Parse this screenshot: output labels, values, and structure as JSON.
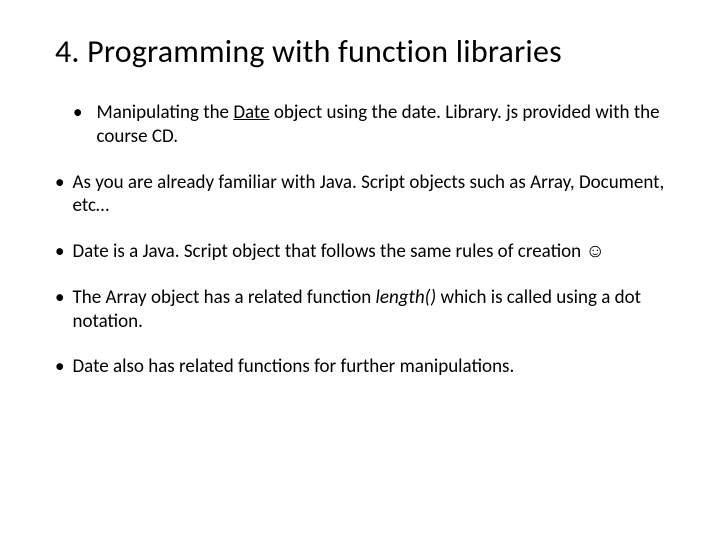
{
  "title": "4. Programming with function libraries",
  "bullets": [
    {
      "pre": "Manipulating the ",
      "u": "Date",
      "post": " object using the date. Library. js provided with the course CD."
    },
    {
      "text": "As you are already familiar with Java. Script objects such as Array, Document, etc…"
    },
    {
      "text": "Date is a Java. Script object that follows the same rules of creation ☺"
    },
    {
      "pre": "The Array object has a related function ",
      "i": "length()",
      "post": " which is called using a dot notation."
    },
    {
      "text": "Date also has related functions for further manipulations."
    }
  ]
}
